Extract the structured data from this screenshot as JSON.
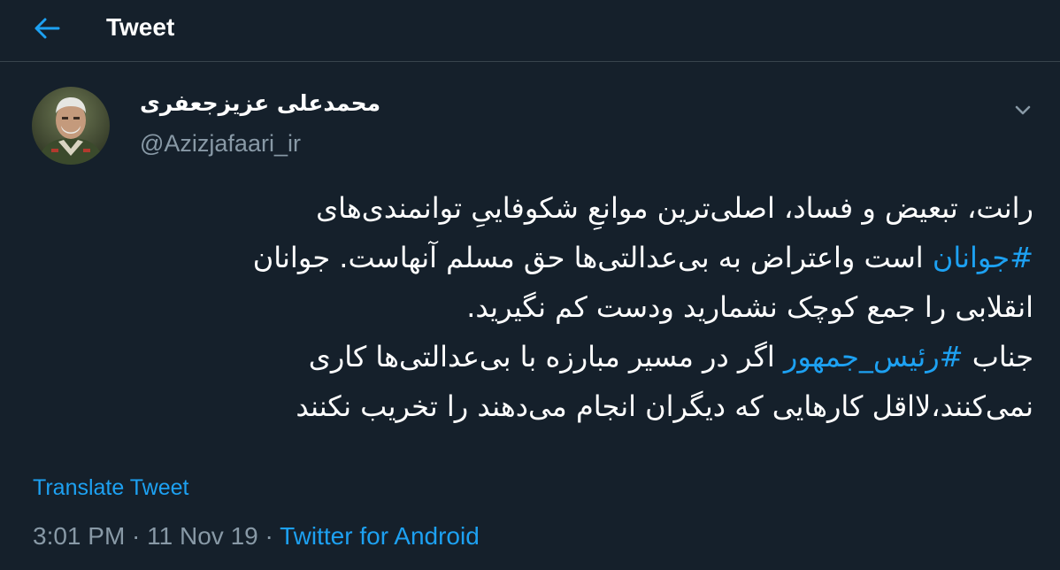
{
  "header": {
    "title": "Tweet",
    "back_icon": "arrow-left-icon"
  },
  "author": {
    "display_name": "محمدعلی عزیزجعفری",
    "handle": "@Azizjafaari_ir",
    "avatar_icon": "avatar-photo"
  },
  "menu": {
    "icon": "chevron-down-icon"
  },
  "tweet": {
    "lines": [
      {
        "segments": [
          {
            "text": "رانت، تبعیض و فساد، اصلی‌ترین موانعِ شکوفاییِ توانمندی‌های"
          }
        ]
      },
      {
        "segments": [
          {
            "text": "#جوانان",
            "hashtag": true
          },
          {
            "text": " است واعتراض به بی‌عدالتی‌ها حق مسلم آنهاست. جوانان"
          }
        ]
      },
      {
        "segments": [
          {
            "text": "انقلابی را جمع کوچک نشمارید ودست کم نگیرید."
          }
        ]
      },
      {
        "segments": [
          {
            "text": "جناب "
          },
          {
            "text": "#رئیس_جمهور",
            "hashtag": true
          },
          {
            "text": " اگر در مسیر مبارزه با بی‌عدالتی‌ها کاری"
          }
        ]
      },
      {
        "segments": [
          {
            "text": "نمی‌کنند،لااقل کارهایی که دیگران انجام می‌دهند را تخریب نکنند"
          }
        ]
      }
    ]
  },
  "translate_label": "Translate Tweet",
  "meta": {
    "time": "3:01 PM",
    "separator": " · ",
    "date": "11 Nov 19",
    "source": "Twitter for Android"
  },
  "colors": {
    "background": "#15202b",
    "accent": "#1da1f2",
    "secondary_text": "#8899a6",
    "divider": "#38444d"
  }
}
